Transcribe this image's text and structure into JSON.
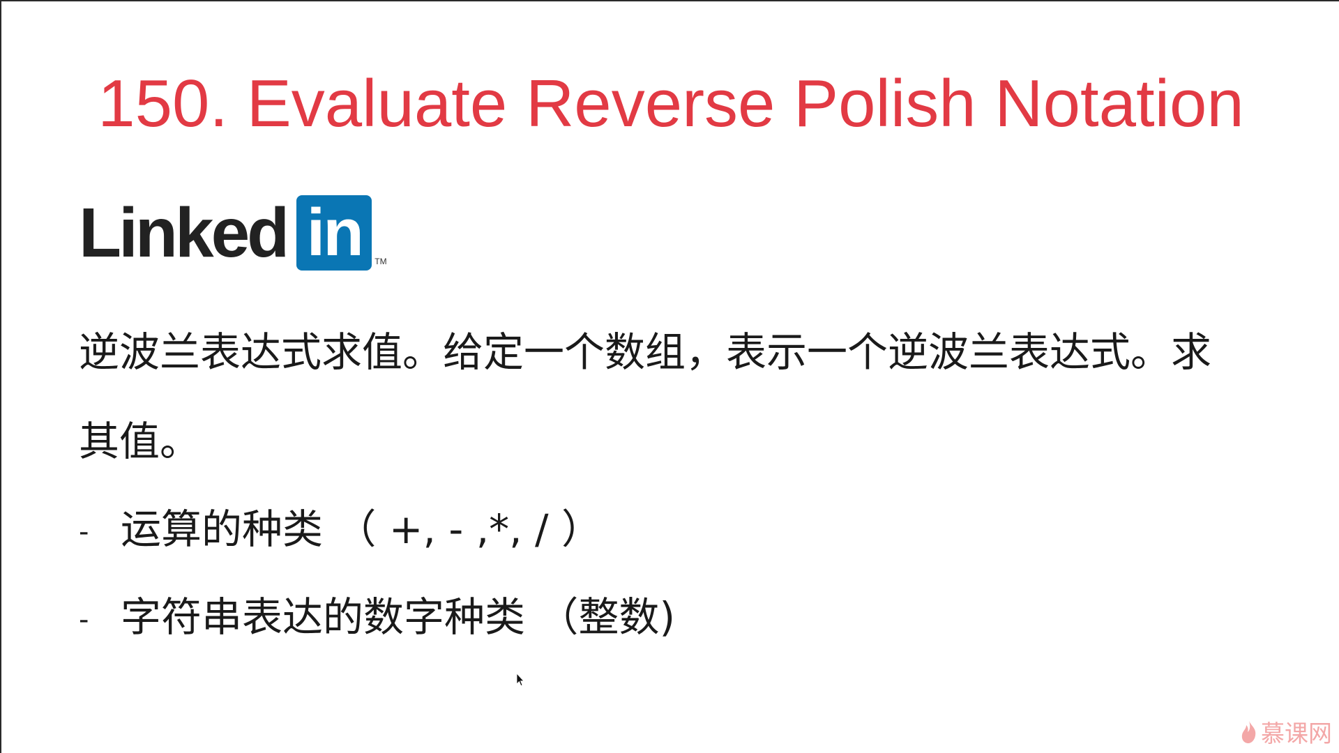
{
  "slide": {
    "title": "150. Evaluate Reverse Polish Notation",
    "logo": {
      "word": "Linked",
      "box_text": "in",
      "tm": "TM",
      "brand_color": "#0a76b4"
    },
    "description_line1": "逆波兰表达式求值。给定一个数组，表示一个逆波兰表达式。求",
    "description_line2": "其值。",
    "bullets": [
      {
        "dash": "-",
        "text": "运算的种类 （ +, - ,*, / ）"
      },
      {
        "dash": "-",
        "text": "字符串表达的数字种类 （整数)"
      }
    ],
    "title_color": "#e23a44"
  },
  "watermark": {
    "text": "慕课网",
    "icon": "flame-icon"
  },
  "cursor": {
    "icon": "mouse-pointer-icon"
  }
}
